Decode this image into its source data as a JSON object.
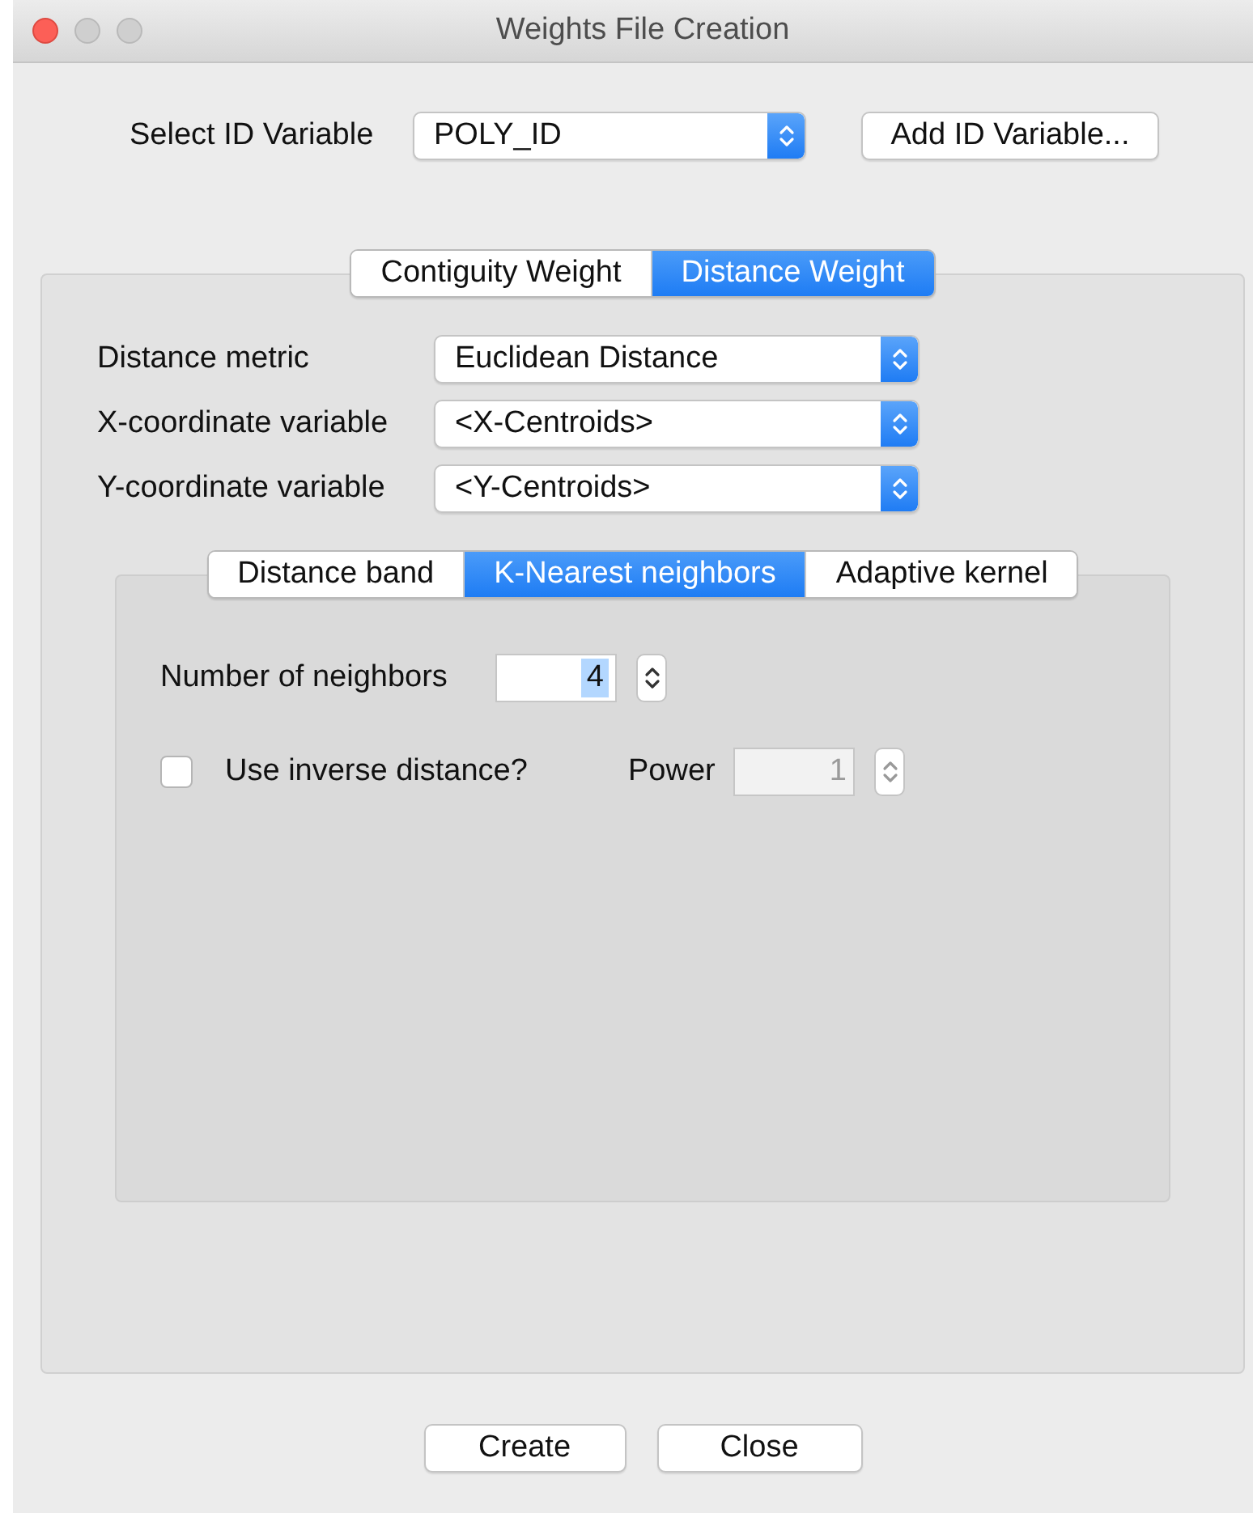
{
  "window": {
    "title": "Weights File Creation"
  },
  "id_variable": {
    "label": "Select ID Variable",
    "value": "POLY_ID"
  },
  "add_button": "Add ID Variable...",
  "tabs": [
    {
      "label": "Contiguity Weight",
      "selected": false
    },
    {
      "label": "Distance Weight",
      "selected": true
    }
  ],
  "fields": [
    {
      "label": "Distance metric",
      "value": "Euclidean Distance"
    },
    {
      "label": "X-coordinate variable",
      "value": "<X-Centroids>"
    },
    {
      "label": "Y-coordinate variable",
      "value": "<Y-Centroids>"
    }
  ],
  "sub_tabs": [
    {
      "label": "Distance band",
      "selected": false
    },
    {
      "label": "K-Nearest neighbors",
      "selected": true
    },
    {
      "label": "Adaptive kernel",
      "selected": false
    }
  ],
  "neighbors": {
    "label": "Number of neighbors",
    "value": "4",
    "text_selected": true
  },
  "inverse": {
    "label": "Use inverse distance?",
    "checked": false
  },
  "power": {
    "label": "Power",
    "value": "1",
    "disabled": true
  },
  "buttons": [
    "Create",
    "Close"
  ]
}
